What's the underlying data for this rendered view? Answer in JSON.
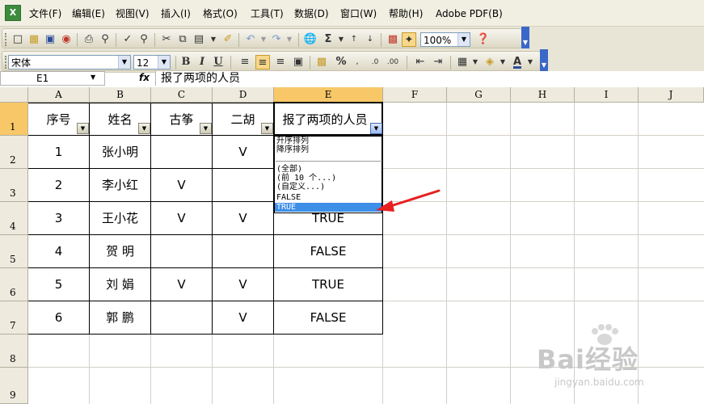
{
  "menu": [
    "文件(F)",
    "编辑(E)",
    "视图(V)",
    "插入(I)",
    "格式(O)",
    "工具(T)",
    "数据(D)",
    "窗口(W)",
    "帮助(H)",
    "Adobe PDF(B)"
  ],
  "toolbar1": {
    "zoom": "100%"
  },
  "toolbar2": {
    "font": "宋体",
    "size": "12",
    "bold": "B",
    "italic": "I",
    "underline": "U",
    "percent": "%"
  },
  "formula_bar": {
    "cell_ref": "E1",
    "fx": "fx",
    "content": "报了两项的人员"
  },
  "columns": [
    "A",
    "B",
    "C",
    "D",
    "E",
    "F",
    "G",
    "H",
    "I",
    "J"
  ],
  "rows": [
    "1",
    "2",
    "3",
    "4",
    "5",
    "6",
    "7",
    "8",
    "9"
  ],
  "table": {
    "headers": [
      "序号",
      "姓名",
      "古筝",
      "二胡",
      "报了两项的人员"
    ],
    "data": [
      [
        "1",
        "张小明",
        "",
        "V",
        ""
      ],
      [
        "2",
        "李小红",
        "V",
        "",
        ""
      ],
      [
        "3",
        "王小花",
        "V",
        "V",
        "TRUE"
      ],
      [
        "4",
        "贺 明",
        "",
        "",
        "FALSE"
      ],
      [
        "5",
        "刘 娟",
        "V",
        "V",
        "TRUE"
      ],
      [
        "6",
        "郭 鹏",
        "",
        "V",
        "FALSE"
      ]
    ]
  },
  "dropdown": {
    "items": [
      "升序排列",
      "降序排列",
      "(全部)",
      "(前 10 个...)",
      "(自定义...)",
      "FALSE",
      "TRUE"
    ],
    "selected": "TRUE"
  },
  "watermark": {
    "text": "Bai经验",
    "url": "jingyan.baidu.com"
  },
  "colors": {
    "selected_header": "#f8c868",
    "highlight": "#3d8fe8",
    "arrow": "#e82020"
  }
}
